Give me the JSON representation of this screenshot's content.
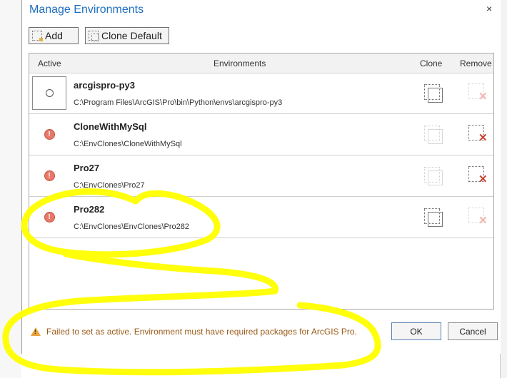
{
  "dialog": {
    "title": "Manage Environments",
    "close_glyph": "×"
  },
  "toolbar": {
    "add_label": "Add",
    "clone_default_label": "Clone Default"
  },
  "grid": {
    "columns": [
      "Active",
      "Environments",
      "Clone",
      "Remove"
    ],
    "rows": [
      {
        "name": "arcgispro-py3",
        "path": "C:\\Program Files\\ArcGIS\\Pro\\bin\\Python\\envs\\arcgispro-py3",
        "status_icon": "radio-icon",
        "clone_enabled": true,
        "remove_enabled": false
      },
      {
        "name": "CloneWithMySql",
        "path": "C:\\EnvClones\\CloneWithMySql",
        "status_icon": "error-icon",
        "clone_enabled": false,
        "remove_enabled": true
      },
      {
        "name": "Pro27",
        "path": "C:\\EnvClones\\Pro27",
        "status_icon": "error-icon",
        "clone_enabled": false,
        "remove_enabled": true
      },
      {
        "name": "Pro282",
        "path": "C:\\EnvClones\\EnvClones\\Pro282",
        "status_icon": "error-icon",
        "clone_enabled": true,
        "remove_enabled": false
      }
    ]
  },
  "error_glyph": "!",
  "warning_glyph": "!",
  "status_message": "Failed to set as active. Environment must have required packages for ArcGIS Pro.",
  "buttons": {
    "ok_label": "OK",
    "cancel_label": "Cancel"
  },
  "colors": {
    "title_blue": "#1f6fbf",
    "highlight_yellow": "#ffff00",
    "error_red": "#e8786a",
    "remove_x": "#c8432e",
    "warning_orange": "#e8a33a"
  }
}
